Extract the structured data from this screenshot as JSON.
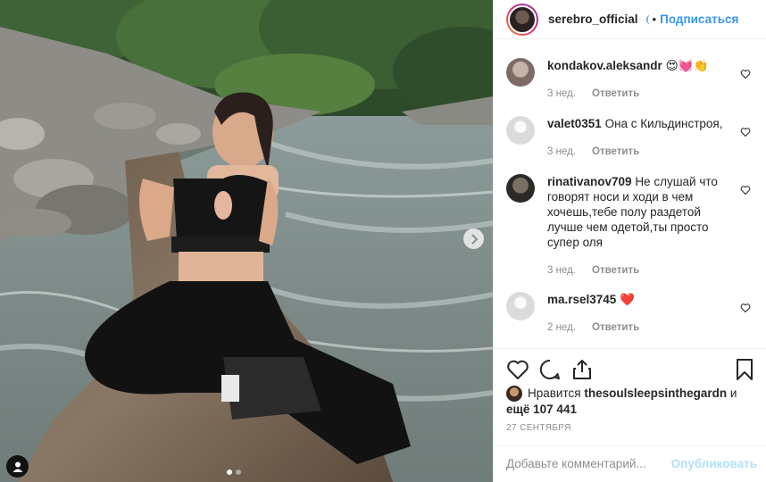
{
  "post": {
    "username": "serebro_official",
    "separator": "•",
    "follow_label": "Подписаться"
  },
  "comments": [
    {
      "user": "kondakov.aleksandr",
      "text": "😍💓👏",
      "time": "3 нед.",
      "reply_label": "Ответить",
      "avatar_color": "#9a8a86"
    },
    {
      "user": "valet0351",
      "text": "Она с Кильдинстроя,",
      "time": "3 нед.",
      "reply_label": "Ответить",
      "avatar_color": "#e6e6e6"
    },
    {
      "user": "rinativanov709",
      "text": "Не слушай что говорят носи и ходи в чем хочешь,тебе полу раздетой лучше чем одетой,ты просто супер оля",
      "time": "3 нед.",
      "reply_label": "Ответить",
      "avatar_color": "#3b3a36"
    },
    {
      "user": "ma.rsel3745",
      "text": "❤️",
      "time": "2 нед.",
      "reply_label": "Ответить",
      "avatar_color": "#e6e6e6"
    }
  ],
  "likes": {
    "prefix": "Нравится",
    "user": "thesoulsleepsinthegardn",
    "middle": "и",
    "count_text": "ещё 107 441"
  },
  "date": "27 сентября",
  "add_comment": {
    "placeholder": "Добавьте комментарий...",
    "publish_label": "Опубликовать"
  },
  "carousel": {
    "slides": 2,
    "active": 1
  },
  "colors": {
    "link": "#3897f0",
    "muted": "#8e8e8e",
    "publish_disabled": "#b2dffc"
  }
}
